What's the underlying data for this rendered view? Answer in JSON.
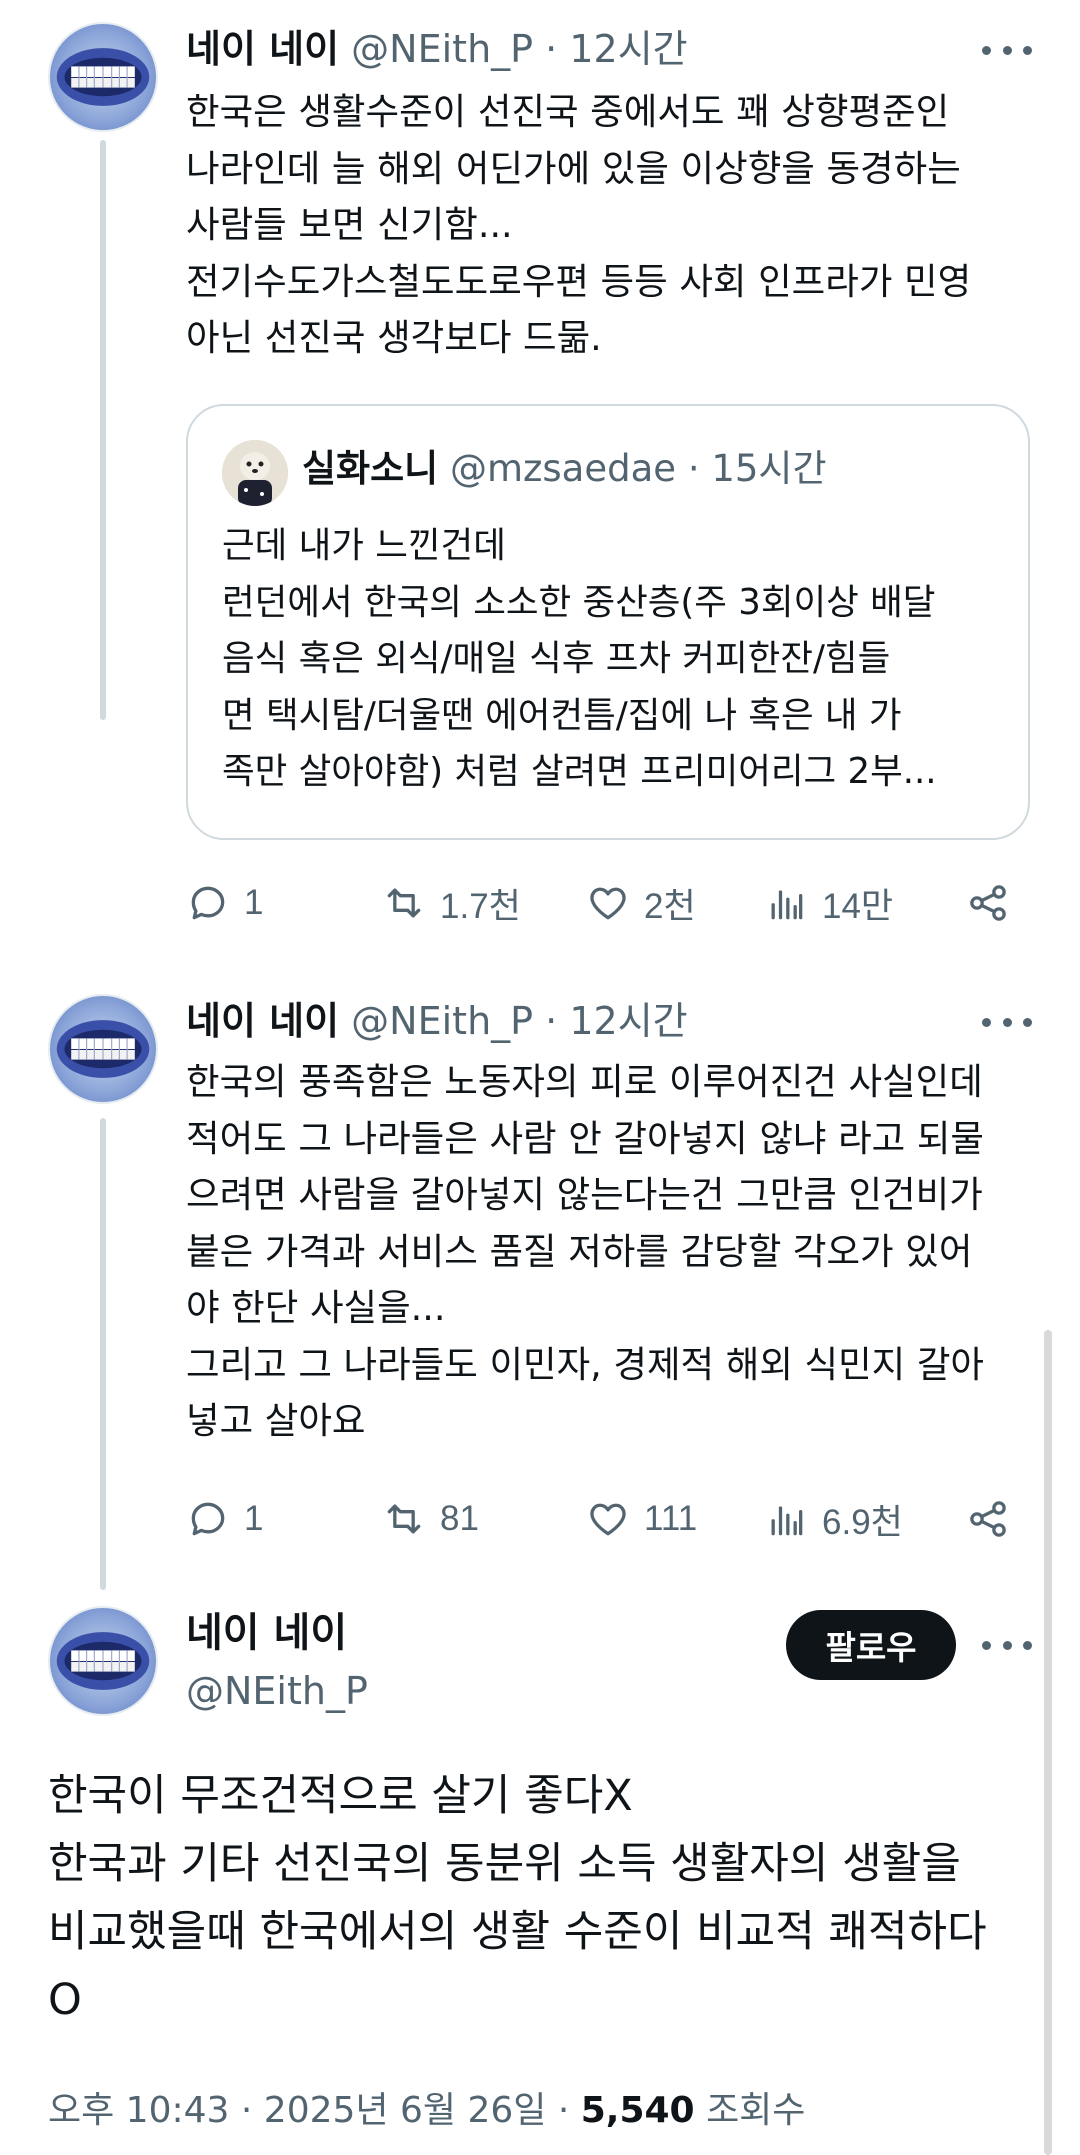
{
  "tweets": [
    {
      "name": "네이 네이",
      "handle": "@NEith_P",
      "sep": "·",
      "time": "12시간",
      "text": "한국은 생활수준이 선진국 중에서도 꽤 상향평준인\n나라인데 늘 해외 어딘가에 있을 이상향을 동경하는\n사람들 보면 신기함...\n전기수도가스철도도로우편 등등 사회 인프라가 민영\n아닌 선진국 생각보다 드묾.",
      "quote": {
        "name": "실화소니",
        "handle": "@mzsaedae",
        "sep": "·",
        "time": "15시간",
        "text": "근데 내가 느낀건데\n런던에서 한국의 소소한 중산층(주 3회이상 배달\n음식 혹은 외식/매일 식후 프차 커피한잔/힘들\n면 택시탐/더울땐 에어컨틈/집에 나 혹은 내 가\n족만 살아야함) 처럼 살려면 프리미어리그 2부..."
      },
      "replies": "1",
      "retweets": "1.7천",
      "likes": "2천",
      "views": "14만"
    },
    {
      "name": "네이 네이",
      "handle": "@NEith_P",
      "sep": "·",
      "time": "12시간",
      "text": "한국의 풍족함은 노동자의 피로 이루어진건 사실인데\n적어도 그 나라들은 사람 안 갈아넣지 않냐 라고 되물\n으려면 사람을 갈아넣지 않는다는건 그만큼 인건비가\n붙은 가격과 서비스 품질 저하를 감당할 각오가 있어\n야 한단 사실을...\n그리고 그 나라들도 이민자, 경제적 해외 식민지 갈아\n넣고 살아요",
      "replies": "1",
      "retweets": "81",
      "likes": "111",
      "views": "6.9천"
    }
  ],
  "main": {
    "name": "네이 네이",
    "handle": "@NEith_P",
    "follow_label": "팔로우",
    "text": "한국이 무조건적으로 살기 좋다X\n한국과 기타 선진국의 동분위 소득 생활자의 생활을\n비교했을때 한국에서의 생활 수준이 비교적 쾌적하다\nO",
    "time": "오후 10:43",
    "sep": "·",
    "date": "2025년 6월 26일",
    "sep2": "·",
    "views_count": "5,540",
    "views_label": "조회수"
  },
  "icons": {
    "reply": "reply-icon",
    "retweet": "retweet-icon",
    "like": "heart-icon",
    "views": "views-icon",
    "share": "share-icon",
    "more": "more-icon"
  },
  "colors": {
    "text": "#0f1419",
    "muted": "#536471",
    "border": "#cfd9de",
    "button": "#0f1419"
  }
}
